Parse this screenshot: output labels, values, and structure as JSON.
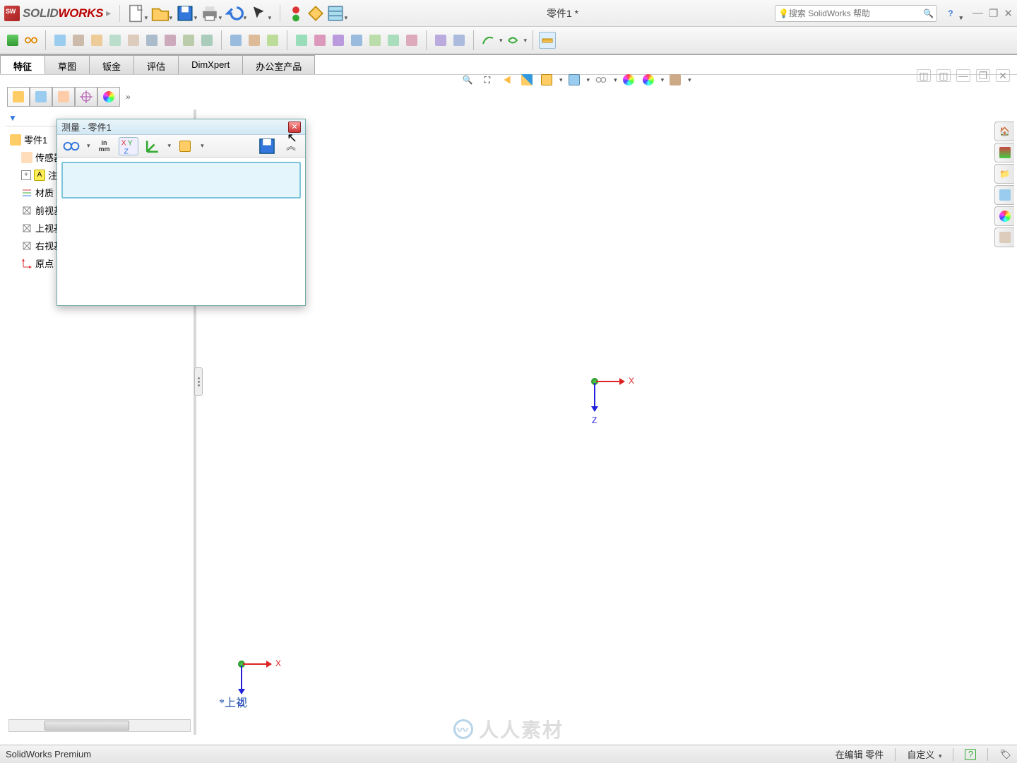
{
  "app": {
    "name_prefix": "SOLID",
    "name_suffix": "WORKS"
  },
  "document_title": "零件1 *",
  "search_placeholder": "搜索 SolidWorks 帮助",
  "ribbon_tabs": [
    "特征",
    "草图",
    "钣金",
    "评估",
    "DimXpert",
    "办公室产品"
  ],
  "tree": {
    "root": "零件1",
    "items": [
      "传感器",
      "注解",
      "材质",
      "前视基准面",
      "上视基准面",
      "右视基准面",
      "原点"
    ]
  },
  "measure_dialog": {
    "title": "测量 - 零件1",
    "unit_top": "in",
    "unit_bot": "mm"
  },
  "viewport": {
    "view_name": "上视",
    "x_label": "X",
    "z_label": "Z"
  },
  "statusbar": {
    "product": "SolidWorks Premium",
    "edit_status": "在编辑 零件",
    "custom": "自定义"
  },
  "watermark": "人人素材"
}
